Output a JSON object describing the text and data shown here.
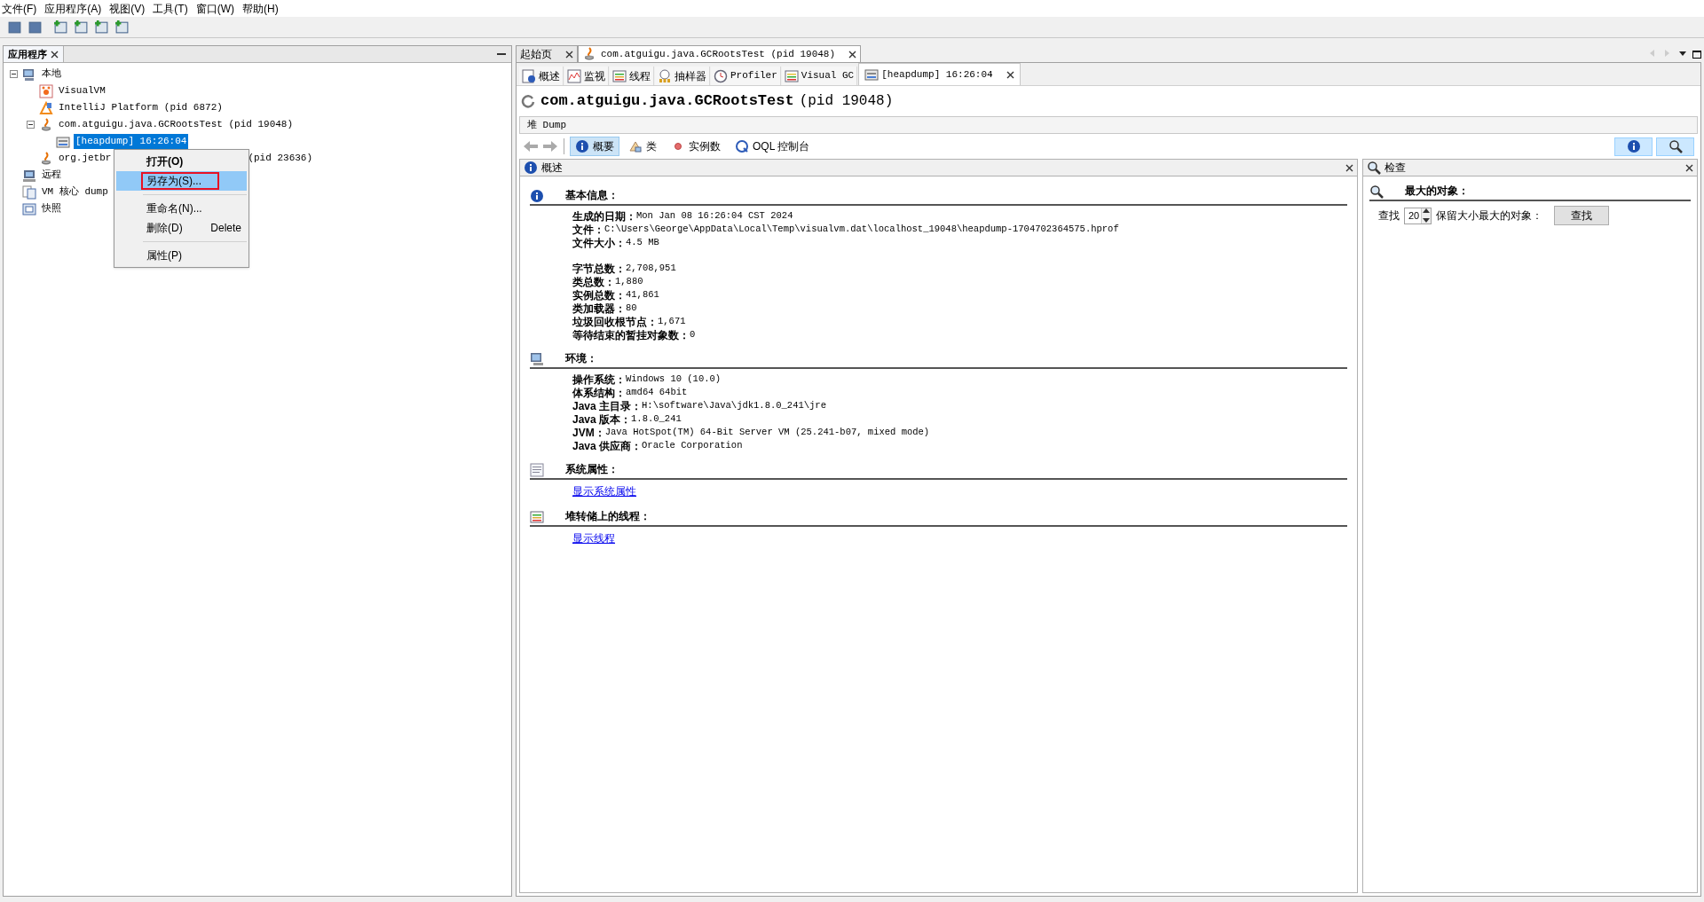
{
  "menu_bar": [
    "文件(F)",
    "应用程序(A)",
    "视图(V)",
    "工具(T)",
    "窗口(W)",
    "帮助(H)"
  ],
  "left_panel": {
    "tab": "应用程序",
    "tree": [
      {
        "label": "本地",
        "kind": "host",
        "expanded": true,
        "selected": false,
        "children": [
          {
            "label": "VisualVM",
            "kind": "visualvm",
            "selected": false
          },
          {
            "label": "IntelliJ Platform (pid 6872)",
            "kind": "intellij",
            "selected": false
          },
          {
            "label": "com.atguigu.java.GCRootsTest (pid 19048)",
            "kind": "java",
            "expanded": true,
            "selected": false,
            "children": [
              {
                "label": "[heapdump] 16:26:04",
                "kind": "heapdump",
                "selected": true
              }
            ]
          },
          {
            "label": "org.jetbr",
            "label_tail": "(pid 23636)",
            "kind": "java",
            "selected": false
          }
        ]
      },
      {
        "label": "远程",
        "kind": "remote",
        "selected": false
      },
      {
        "label": "VM 核心 dump",
        "kind": "coredump",
        "selected": false
      },
      {
        "label": "快照",
        "kind": "snapshot",
        "selected": false
      }
    ]
  },
  "context_menu": [
    {
      "kind": "item",
      "label": "打开(O)",
      "bold": true,
      "selected": false,
      "annotated": false
    },
    {
      "kind": "item",
      "label": "另存为(S)...",
      "bold": false,
      "selected": true,
      "annotated": true
    },
    {
      "kind": "separator"
    },
    {
      "kind": "item",
      "label": "重命名(N)...",
      "bold": false,
      "selected": false,
      "annotated": false
    },
    {
      "kind": "item",
      "label": "删除(D)",
      "shortcut": "Delete",
      "bold": false,
      "selected": false,
      "annotated": false
    },
    {
      "kind": "separator"
    },
    {
      "kind": "item",
      "label": "属性(P)",
      "bold": false,
      "selected": false,
      "annotated": false
    }
  ],
  "doc_tabs": [
    {
      "label": "起始页",
      "kind": "plain",
      "selected": false
    },
    {
      "label": "com.atguigu.java.GCRootsTest (pid 19048)",
      "kind": "java",
      "selected": true
    }
  ],
  "view_tabs": [
    {
      "label": "概述",
      "kind": "overview",
      "selected": false,
      "closable": false
    },
    {
      "label": "监视",
      "kind": "monitor",
      "selected": false,
      "closable": false
    },
    {
      "label": "线程",
      "kind": "threads",
      "selected": false,
      "closable": false
    },
    {
      "label": "抽样器",
      "kind": "sampler",
      "selected": false,
      "closable": false
    },
    {
      "label": "Profiler",
      "kind": "profiler",
      "selected": false,
      "closable": false
    },
    {
      "label": "Visual GC",
      "kind": "visualgc",
      "selected": false,
      "closable": false
    },
    {
      "label": "[heapdump] 16:26:04",
      "kind": "heapdump",
      "selected": true,
      "closable": true
    }
  ],
  "title": {
    "name": "com.atguigu.java.GCRootsTest",
    "pid": "(pid 19048)"
  },
  "heap_bar": "堆 Dump",
  "heap_views": [
    {
      "label": "概要",
      "kind": "info",
      "selected": true
    },
    {
      "label": "类",
      "kind": "classes",
      "selected": false
    },
    {
      "label": "实例数",
      "kind": "instances",
      "selected": false
    },
    {
      "label": "OQL 控制台",
      "kind": "oql",
      "selected": false
    }
  ],
  "panel_toggles": [
    {
      "kind": "info",
      "selected": true
    },
    {
      "kind": "search",
      "selected": true
    }
  ],
  "overview": {
    "title": "概述",
    "sections": [
      {
        "title": "基本信息：",
        "kind": "info",
        "groups": [
          [
            {
              "label": "生成的日期：",
              "value": "Mon Jan 08 16:26:04 CST 2024"
            },
            {
              "label": "文件：",
              "value": "C:\\Users\\George\\AppData\\Local\\Temp\\visualvm.dat\\localhost_19048\\heapdump-1704702364575.hprof"
            },
            {
              "label": "文件大小：",
              "value": "4.5 MB"
            }
          ],
          [
            {
              "label": "字节总数：",
              "value": "2,708,951"
            },
            {
              "label": "类总数：",
              "value": "1,880"
            },
            {
              "label": "实例总数：",
              "value": "41,861"
            },
            {
              "label": "类加载器：",
              "value": "80"
            },
            {
              "label": "垃圾回收根节点：",
              "value": "1,671"
            },
            {
              "label": "等待结束的暂挂对象数：",
              "value": "0"
            }
          ]
        ]
      },
      {
        "title": "环境：",
        "kind": "env",
        "groups": [
          [
            {
              "label": "操作系统：",
              "value": "Windows 10 (10.0)"
            },
            {
              "label": "体系结构：",
              "value": "amd64 64bit"
            },
            {
              "label": "Java 主目录：",
              "value": "H:\\software\\Java\\jdk1.8.0_241\\jre"
            },
            {
              "label": "Java 版本：",
              "value": "1.8.0_241"
            },
            {
              "label": "JVM：",
              "value": "Java HotSpot(TM) 64-Bit Server VM (25.241-b07, mixed mode)"
            },
            {
              "label": "Java 供应商：",
              "value": "Oracle Corporation"
            }
          ]
        ]
      },
      {
        "title": "系统属性：",
        "kind": "props",
        "link": "显示系统属性"
      },
      {
        "title": "堆转储上的线程：",
        "kind": "threads",
        "link": "显示线程"
      }
    ]
  },
  "inspect": {
    "title": "检查",
    "section": "最大的对象：",
    "find_label": "查找",
    "count": "20",
    "count_label": "保留大小最大的对象：",
    "button": "查找"
  }
}
